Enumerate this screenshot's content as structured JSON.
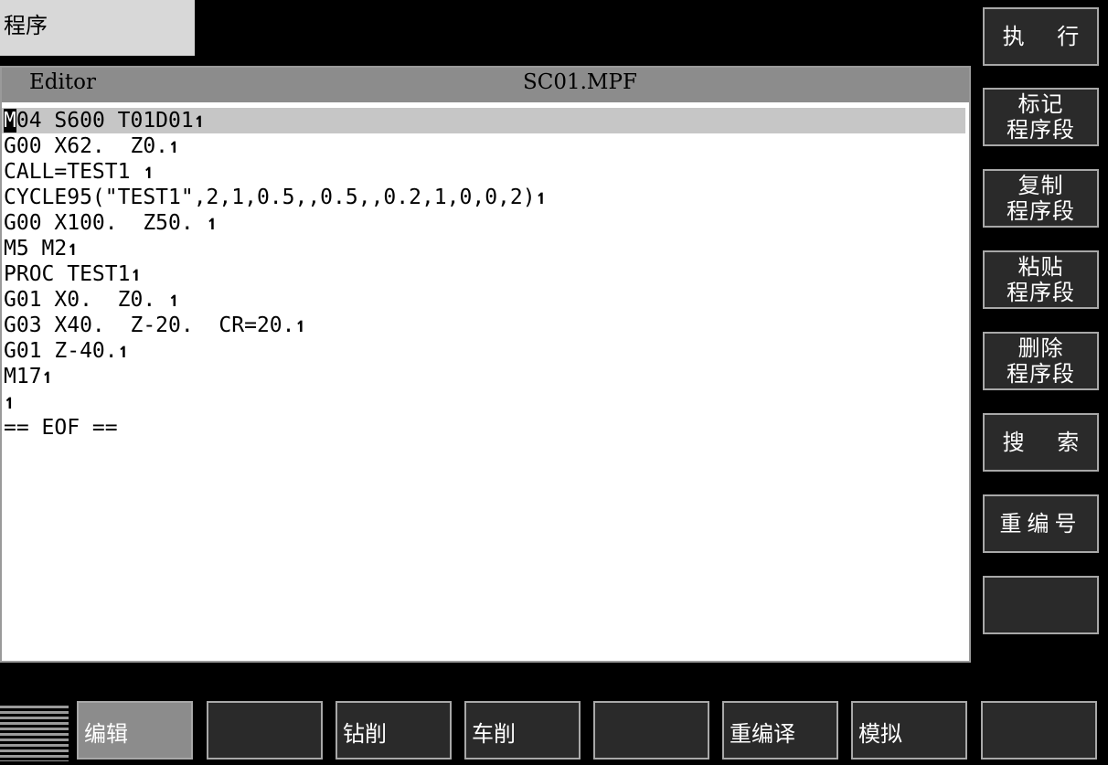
{
  "window": {
    "title": "程序"
  },
  "editor": {
    "label": "Editor",
    "filename": "SC01.MPF",
    "cursor_char": "M",
    "eol_mark": "↿",
    "lines": [
      {
        "text": "04 S600 T01D01",
        "eol": true
      },
      {
        "text": "G00 X62.  Z0.",
        "eol": true
      },
      {
        "text": "CALL=TEST1 ",
        "eol": true
      },
      {
        "text": "CYCLE95(\"TEST1\",2,1,0.5,,0.5,,0.2,1,0,0,2)",
        "eol": true
      },
      {
        "text": "G00 X100.  Z50. ",
        "eol": true
      },
      {
        "text": "M5 M2",
        "eol": true
      },
      {
        "text": "PROC TEST1",
        "eol": true
      },
      {
        "text": "G01 X0.  Z0. ",
        "eol": true
      },
      {
        "text": "G03 X40.  Z-20.  CR=20.",
        "eol": true
      },
      {
        "text": "G01 Z-40.",
        "eol": true
      },
      {
        "text": "M17",
        "eol": true
      },
      {
        "text": "",
        "eol": true
      },
      {
        "text": "== EOF ==",
        "eol": false
      }
    ]
  },
  "side_buttons": {
    "execute": "执 行",
    "mark_1": "标记",
    "mark_2": "程序段",
    "copy_1": "复制",
    "copy_2": "程序段",
    "paste_1": "粘贴",
    "paste_2": "程序段",
    "delete_1": "删除",
    "delete_2": "程序段",
    "search": "搜 索",
    "renumber": "重编号"
  },
  "bottom_buttons": {
    "edit": "编辑",
    "drill": "钻削",
    "turn": "车削",
    "recompile": "重编译",
    "simulate": "模拟"
  }
}
